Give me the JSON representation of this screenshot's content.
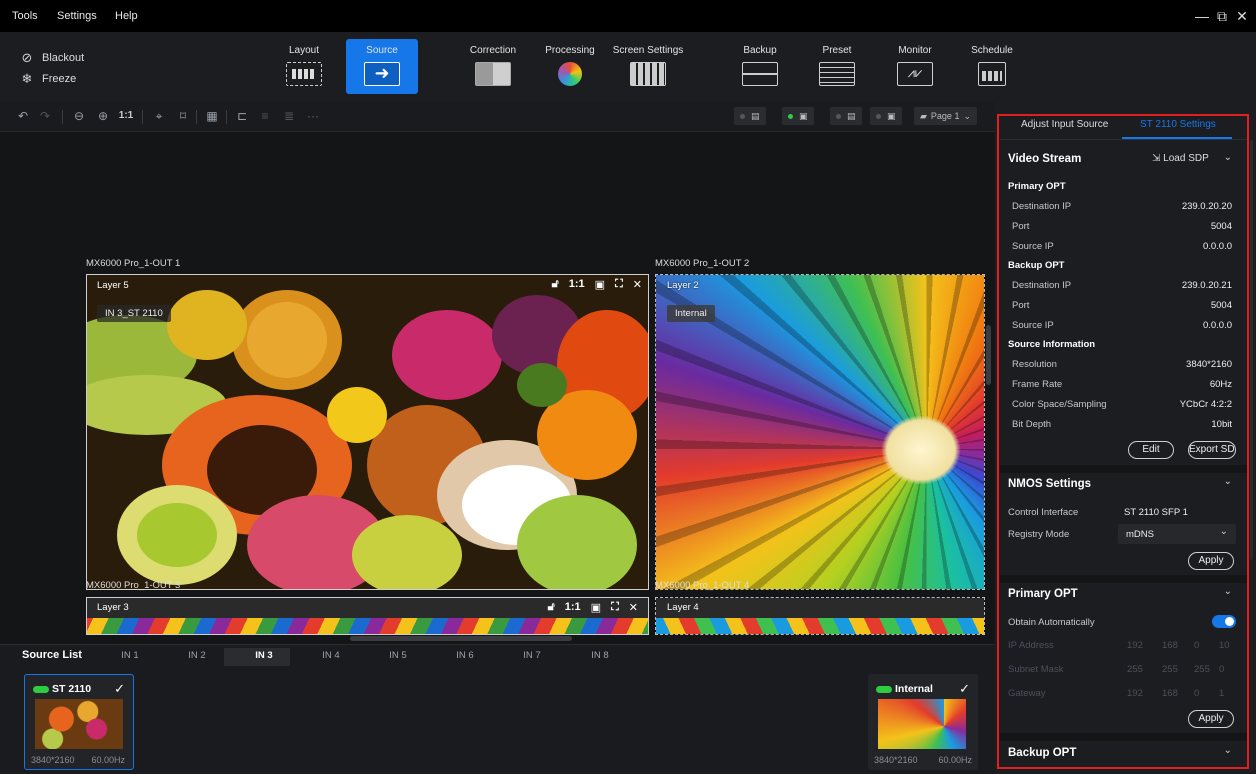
{
  "menubar": {
    "items": [
      "Tools",
      "Settings",
      "Help"
    ]
  },
  "window_controls": {
    "minimize": "—",
    "maximize": "⧉",
    "close": "✕"
  },
  "toolbar": {
    "blackout": "Blackout",
    "freeze": "Freeze",
    "buttons": [
      "Layout",
      "Source",
      "Correction",
      "Processing",
      "Screen Settings",
      "Backup",
      "Preset",
      "Monitor",
      "Schedule"
    ]
  },
  "canvasbar": {
    "zoom_ratio": "1:1",
    "more": "···",
    "page": "Page 1"
  },
  "canvas": {
    "outputs": [
      "MX6000 Pro_1-OUT 1",
      "MX6000 Pro_1-OUT 2",
      "MX6000 Pro_1-OUT 3",
      "MX6000 Pro_1-OUT 4"
    ],
    "layers": [
      {
        "name": "Layer 5",
        "tag": "IN 3_ST 2110",
        "ratio": "1:1"
      },
      {
        "name": "Layer 2",
        "tag": "Internal"
      },
      {
        "name": "Layer 3",
        "ratio": "1:1"
      },
      {
        "name": "Layer 4"
      }
    ]
  },
  "source_list": {
    "title": "Source List",
    "tabs": [
      "IN 1",
      "IN 2",
      "IN 3",
      "IN 4",
      "IN 5",
      "IN 6",
      "IN 7",
      "IN 8"
    ],
    "active_tab": "IN 3",
    "cards": [
      {
        "name": "ST 2110",
        "resolution": "3840*2160",
        "rate": "60.00Hz",
        "selected": true
      },
      {
        "name": "Internal",
        "resolution": "3840*2160",
        "rate": "60.00Hz",
        "selected": false
      }
    ]
  },
  "panel": {
    "tabs": [
      "Adjust Input Source",
      "ST 2110 Settings"
    ],
    "active_tab": "ST 2110 Settings",
    "video_stream": {
      "title": "Video Stream",
      "load_sdp": "Load SDP",
      "primary_title": "Primary OPT",
      "primary": [
        {
          "k": "Destination IP",
          "v": "239.0.20.20"
        },
        {
          "k": "Port",
          "v": "5004"
        },
        {
          "k": "Source IP",
          "v": "0.0.0.0"
        }
      ],
      "backup_title": "Backup OPT",
      "backup": [
        {
          "k": "Destination IP",
          "v": "239.0.20.21"
        },
        {
          "k": "Port",
          "v": "5004"
        },
        {
          "k": "Source IP",
          "v": "0.0.0.0"
        }
      ],
      "info_title": "Source Information",
      "info": [
        {
          "k": "Resolution",
          "v": "3840*2160"
        },
        {
          "k": "Frame Rate",
          "v": "60Hz"
        },
        {
          "k": "Color Space/Sampling",
          "v": "YCbCr 4:2:2"
        },
        {
          "k": "Bit Depth",
          "v": "10bit"
        }
      ],
      "edit": "Edit",
      "export": "Export SDP"
    },
    "nmos": {
      "title": "NMOS Settings",
      "control_label": "Control Interface",
      "control_value": "ST 2110 SFP 1",
      "registry_label": "Registry Mode",
      "registry_value": "mDNS",
      "apply": "Apply"
    },
    "primary_opt": {
      "title": "Primary OPT",
      "obtain": "Obtain Automatically",
      "toggle_on": true,
      "ip_label": "IP Address",
      "ip": [
        "192",
        "168",
        "0",
        "10"
      ],
      "mask_label": "Subnet Mask",
      "mask": [
        "255",
        "255",
        "255",
        "0"
      ],
      "gw_label": "Gateway",
      "gw": [
        "192",
        "168",
        "0",
        "1"
      ],
      "apply": "Apply"
    },
    "backup_opt": {
      "title": "Backup OPT"
    }
  },
  "colors": {
    "accent": "#1677e8",
    "highlight_border": "#e02020",
    "status_green": "#2ecc40"
  }
}
